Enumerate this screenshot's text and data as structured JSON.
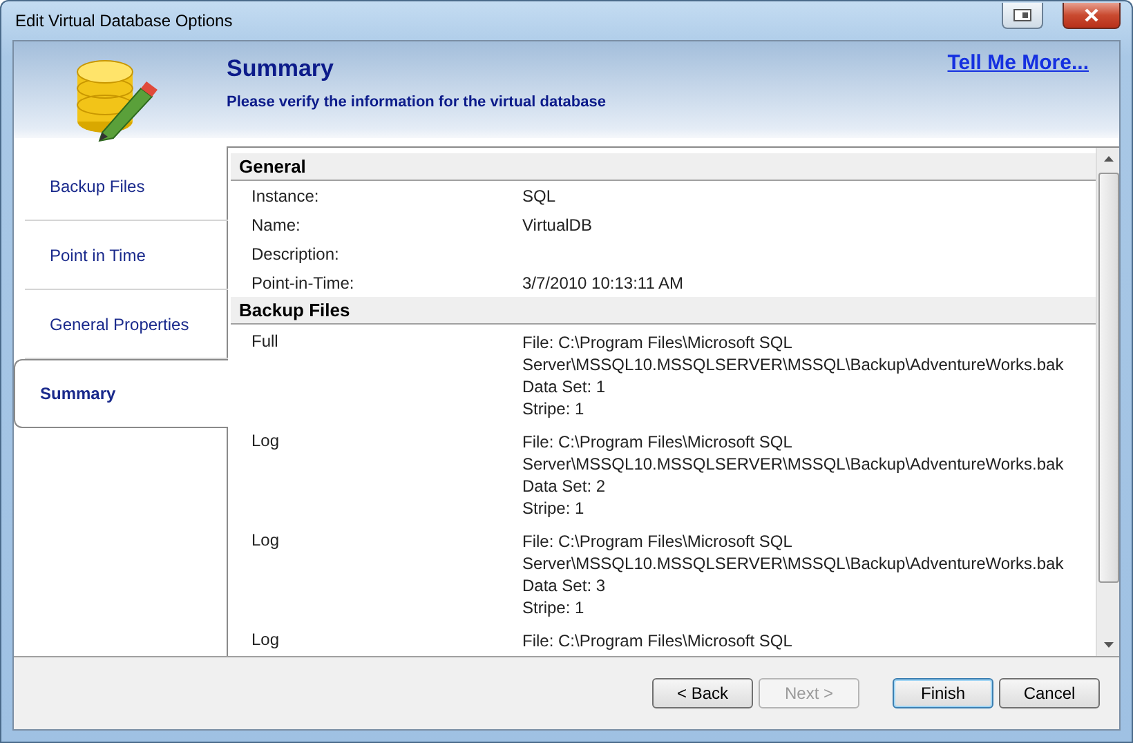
{
  "window": {
    "title": "Edit Virtual Database Options"
  },
  "header": {
    "title": "Summary",
    "subtitle": "Please verify the information for the virtual database",
    "help_link": "Tell Me More..."
  },
  "sidebar": {
    "items": [
      {
        "label": "Backup Files",
        "selected": false
      },
      {
        "label": "Point in Time",
        "selected": false
      },
      {
        "label": "General Properties",
        "selected": false
      },
      {
        "label": "Summary",
        "selected": true
      }
    ]
  },
  "summary": {
    "sections": [
      {
        "title": "General",
        "kind": "properties",
        "rows": [
          {
            "label": "Instance:",
            "value": "SQL"
          },
          {
            "label": "Name:",
            "value": "VirtualDB"
          },
          {
            "label": "Description:"
          },
          {
            "label": "Point-in-Time:",
            "value": "3/7/2010 10:13:11 AM"
          }
        ]
      },
      {
        "title": "Backup Files",
        "kind": "files",
        "rows": [
          {
            "label": "Full",
            "lines": [
              "File: C:\\Program Files\\Microsoft SQL",
              "Server\\MSSQL10.MSSQLSERVER\\MSSQL\\Backup\\AdventureWorks.bak",
              "Data Set: 1",
              "Stripe: 1"
            ]
          },
          {
            "label": "Log",
            "lines": [
              "File: C:\\Program Files\\Microsoft SQL",
              "Server\\MSSQL10.MSSQLSERVER\\MSSQL\\Backup\\AdventureWorks.bak",
              "Data Set: 2",
              "Stripe: 1"
            ]
          },
          {
            "label": "Log",
            "lines": [
              "File: C:\\Program Files\\Microsoft SQL",
              "Server\\MSSQL10.MSSQLSERVER\\MSSQL\\Backup\\AdventureWorks.bak",
              "Data Set: 3",
              "Stripe: 1"
            ]
          },
          {
            "label": "Log",
            "lines": [
              "File: C:\\Program Files\\Microsoft SQL"
            ]
          }
        ]
      }
    ]
  },
  "buttons": [
    {
      "label": "< Back",
      "disabled": false,
      "default": false
    },
    {
      "label": "Next >",
      "disabled": true,
      "default": false
    },
    {
      "label": "Finish",
      "disabled": false,
      "default": true
    },
    {
      "label": "Cancel",
      "disabled": false,
      "default": false
    }
  ]
}
